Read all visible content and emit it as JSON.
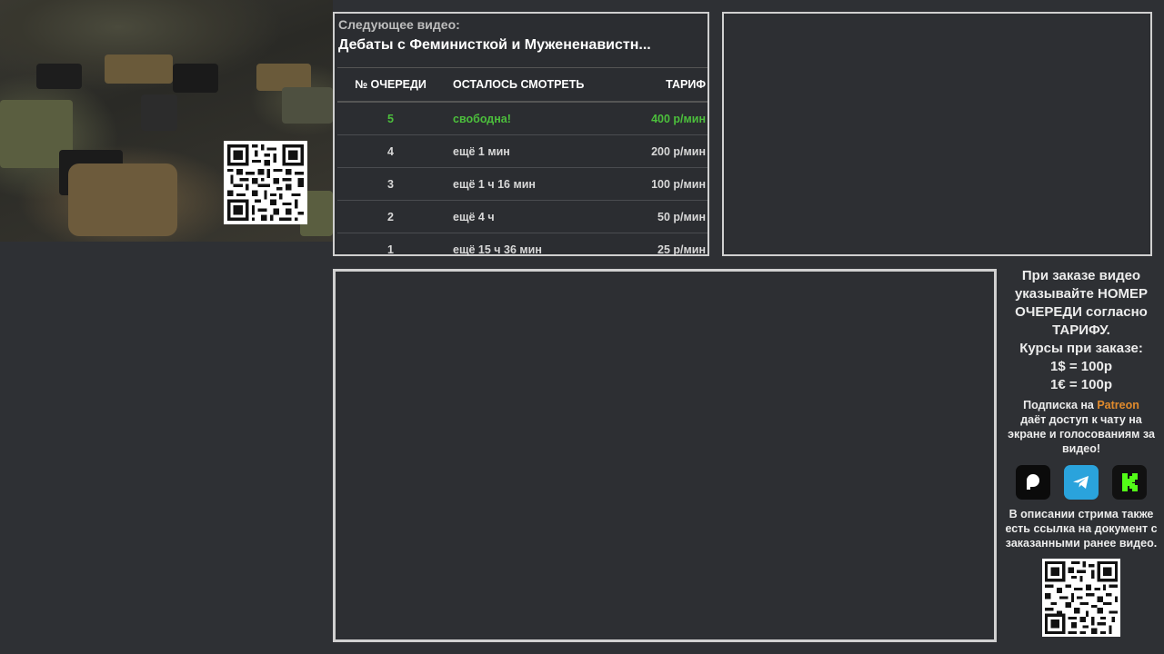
{
  "next_video": {
    "label": "Следующее видео:",
    "title": "Дебаты с Феминисткой и Мужененавистн..."
  },
  "queue_table": {
    "headers": [
      "№ ОЧЕРЕДИ",
      "ОСТАЛОСЬ СМОТРЕТЬ",
      "ТАРИФ"
    ],
    "rows": [
      {
        "num": "5",
        "remaining": "свободна!",
        "rate": "400 р/мин"
      },
      {
        "num": "4",
        "remaining": "ещё 1 мин",
        "rate": "200 р/мин"
      },
      {
        "num": "3",
        "remaining": "ещё 1 ч 16 мин",
        "rate": "100 р/мин"
      },
      {
        "num": "2",
        "remaining": "ещё 4 ч",
        "rate": "50 р/мин"
      },
      {
        "num": "1",
        "remaining": "ещё 15 ч 36 мин",
        "rate": "25 р/мин"
      }
    ]
  },
  "info": {
    "order_note": "При заказе видео указывайте НОМЕР ОЧЕРЕДИ согласно ТАРИФУ.",
    "rates_title": "Курсы при заказе:",
    "rate_usd": "1$ = 100р",
    "rate_eur": "1€ = 100р",
    "sub_prefix": "Подписка на ",
    "sub_link": "Patreon",
    "sub_suffix": "даёт доступ к чату на экране и голосованиям за видео!",
    "doc_note": "В описании стрима также есть ссылка на документ с заказанными ранее видео."
  },
  "icons": [
    "patreon-icon",
    "telegram-icon",
    "kick-icon"
  ],
  "colors": {
    "background": "#2e3034",
    "free_status": "#4cbf3c",
    "patreon": "#e08a2c",
    "telegram": "#2aa3dc",
    "kick": "#53fc18"
  }
}
